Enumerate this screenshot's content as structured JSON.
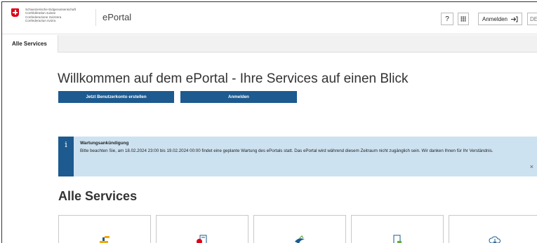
{
  "header": {
    "confederation": [
      "Schweizerische Eidgenossenschaft",
      "Confédération suisse",
      "Confederazione Svizzera",
      "Confederaziun svizra"
    ],
    "brand": "ePortal",
    "help_label": "?",
    "login_label": "Anmelden",
    "login_icon": "login-arrow-icon",
    "apps_icon": "apps-grid-icon",
    "language": "DE"
  },
  "tabs": [
    {
      "label": "Alle Services",
      "active": true
    }
  ],
  "welcome": {
    "title": "Willkommen auf dem ePortal - Ihre Services auf einen Blick",
    "create_account_label": "Jetzt Benutzerkonto erstellen",
    "login_label": "Anmelden"
  },
  "alert": {
    "icon": "info-icon",
    "icon_text": "i",
    "title": "Wartungsankündigung",
    "text": "Bitte beachten Sie, am 18.02.2024 23:00 bis 19.02.2024 00:00 findet eine geplante Wartung des ePortals statt. Das ePortal wird während diesem Zeitraum nicht zugänglich sein. Wir danken Ihnen für Ihr Verständnis.",
    "close_label": "×",
    "color": "#cde2f0"
  },
  "services": {
    "title": "Alle Services",
    "cards": [
      {
        "icon": "construction-icon"
      },
      {
        "icon": "document-chart-icon"
      },
      {
        "icon": "bird-icon"
      },
      {
        "icon": "document-stamp-icon"
      },
      {
        "icon": "cloud-download-icon"
      }
    ]
  },
  "colors": {
    "primary": "#1c5a8f",
    "swiss_red": "#dc0018"
  }
}
